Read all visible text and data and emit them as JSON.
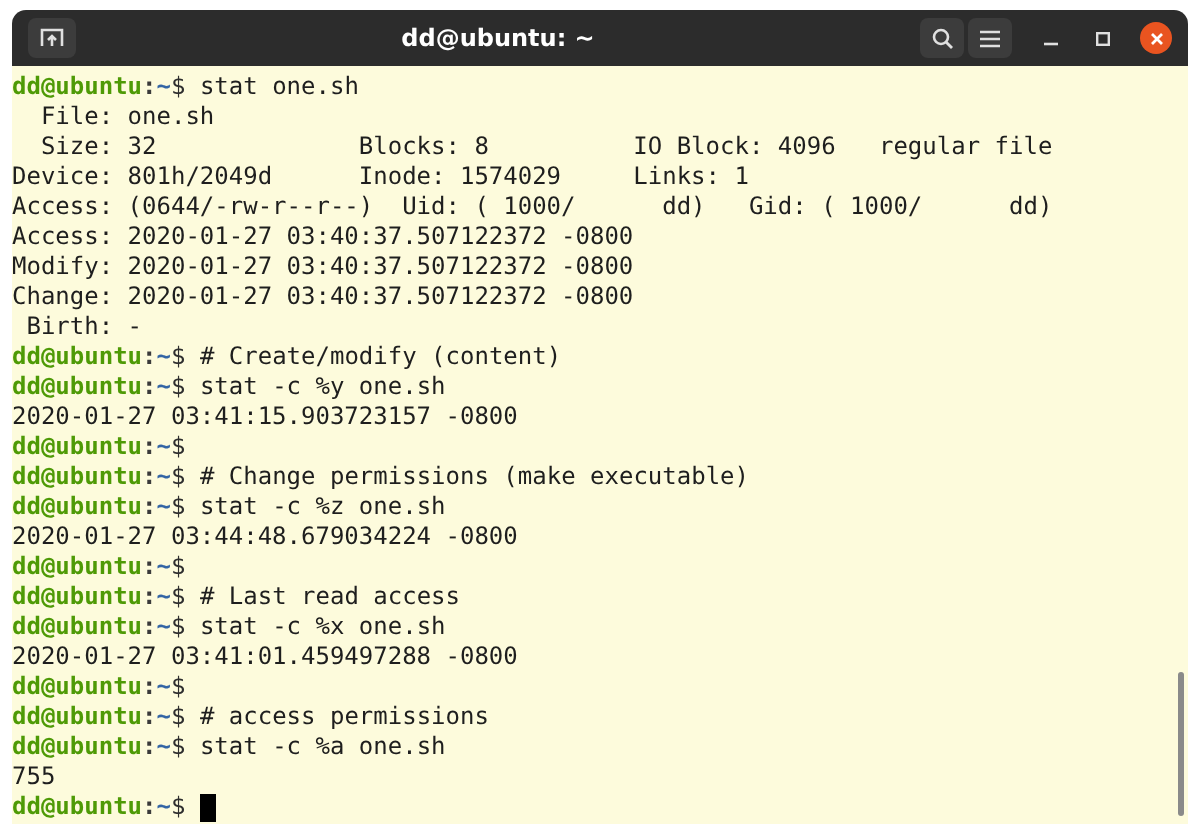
{
  "window": {
    "title": "dd@ubuntu: ~"
  },
  "terminal": {
    "lines": [
      {
        "kind": "prompt",
        "host": "dd@ubuntu",
        "sep": ":",
        "path": "~",
        "symbol": "$",
        "command": "stat one.sh"
      },
      {
        "kind": "output",
        "text": "  File: one.sh"
      },
      {
        "kind": "output",
        "text": "  Size: 32        \tBlocks: 8          IO Block: 4096   regular file"
      },
      {
        "kind": "output",
        "text": "Device: 801h/2049d\tInode: 1574029     Links: 1"
      },
      {
        "kind": "output",
        "text": "Access: (0644/-rw-r--r--)  Uid: ( 1000/      dd)   Gid: ( 1000/      dd)"
      },
      {
        "kind": "output",
        "text": "Access: 2020-01-27 03:40:37.507122372 -0800"
      },
      {
        "kind": "output",
        "text": "Modify: 2020-01-27 03:40:37.507122372 -0800"
      },
      {
        "kind": "output",
        "text": "Change: 2020-01-27 03:40:37.507122372 -0800"
      },
      {
        "kind": "output",
        "text": " Birth: -"
      },
      {
        "kind": "prompt",
        "host": "dd@ubuntu",
        "sep": ":",
        "path": "~",
        "symbol": "$",
        "command": "# Create/modify (content)"
      },
      {
        "kind": "prompt",
        "host": "dd@ubuntu",
        "sep": ":",
        "path": "~",
        "symbol": "$",
        "command": "stat -c %y one.sh"
      },
      {
        "kind": "output",
        "text": "2020-01-27 03:41:15.903723157 -0800"
      },
      {
        "kind": "prompt",
        "host": "dd@ubuntu",
        "sep": ":",
        "path": "~",
        "symbol": "$"
      },
      {
        "kind": "prompt",
        "host": "dd@ubuntu",
        "sep": ":",
        "path": "~",
        "symbol": "$",
        "command": "# Change permissions (make executable)"
      },
      {
        "kind": "prompt",
        "host": "dd@ubuntu",
        "sep": ":",
        "path": "~",
        "symbol": "$",
        "command": "stat -c %z one.sh"
      },
      {
        "kind": "output",
        "text": "2020-01-27 03:44:48.679034224 -0800"
      },
      {
        "kind": "prompt",
        "host": "dd@ubuntu",
        "sep": ":",
        "path": "~",
        "symbol": "$"
      },
      {
        "kind": "prompt",
        "host": "dd@ubuntu",
        "sep": ":",
        "path": "~",
        "symbol": "$",
        "command": "# Last read access"
      },
      {
        "kind": "prompt",
        "host": "dd@ubuntu",
        "sep": ":",
        "path": "~",
        "symbol": "$",
        "command": "stat -c %x one.sh"
      },
      {
        "kind": "output",
        "text": "2020-01-27 03:41:01.459497288 -0800"
      },
      {
        "kind": "prompt",
        "host": "dd@ubuntu",
        "sep": ":",
        "path": "~",
        "symbol": "$"
      },
      {
        "kind": "prompt",
        "host": "dd@ubuntu",
        "sep": ":",
        "path": "~",
        "symbol": "$",
        "command": "# access permissions"
      },
      {
        "kind": "prompt",
        "host": "dd@ubuntu",
        "sep": ":",
        "path": "~",
        "symbol": "$",
        "command": "stat -c %a one.sh"
      },
      {
        "kind": "output",
        "text": "755"
      },
      {
        "kind": "prompt",
        "host": "dd@ubuntu",
        "sep": ":",
        "path": "~",
        "symbol": "$",
        "cursor": true
      }
    ]
  }
}
